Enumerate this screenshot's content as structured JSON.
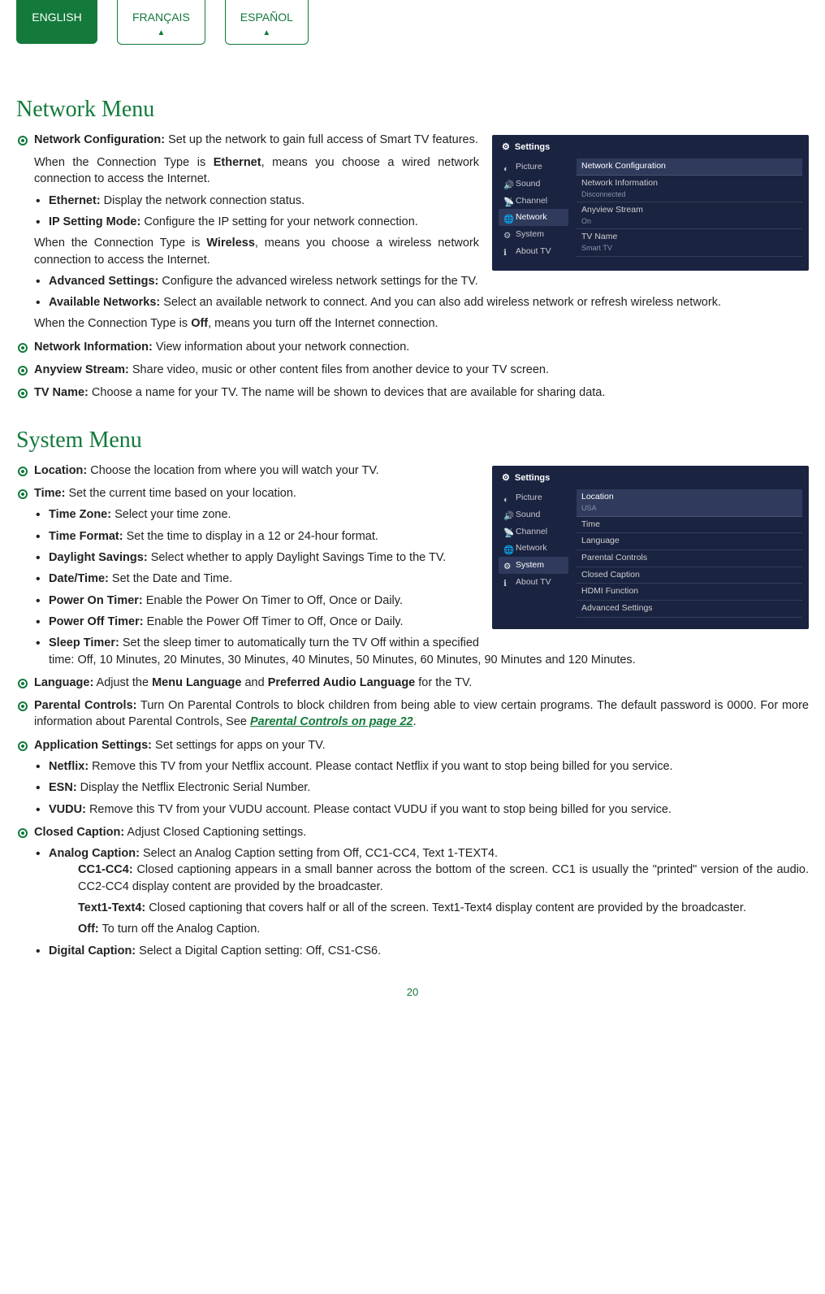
{
  "langs": {
    "en": "ENGLISH",
    "fr": "FRANÇAIS",
    "es": "ESPAÑOL"
  },
  "sec1": {
    "title": "Network Menu",
    "netconf": {
      "label": "Network Configuration:",
      "text": " Set up the network to gain full access of Smart TV features."
    },
    "ethernet_intro_a": "When the Connection Type is ",
    "ethernet_intro_b": "Ethernet",
    "ethernet_intro_c": ", means you choose a wired network connection to access the Internet.",
    "eth": {
      "label": "Ethernet:",
      "text": " Display the network connection status."
    },
    "ip": {
      "label": "IP Setting Mode:",
      "text": " Configure the IP setting for your network connection."
    },
    "wireless_intro_a": "When the Connection Type is ",
    "wireless_intro_b": "Wireless",
    "wireless_intro_c": ", means you choose a wireless network connection to access the Internet.",
    "adv": {
      "label": "Advanced Settings:",
      "text": " Configure the advanced wireless network settings for the TV."
    },
    "avail": {
      "label": "Available Networks:",
      "text": " Select an available network to connect. And you can also add wireless network or refresh wireless network."
    },
    "off_intro_a": "When the Connection Type is ",
    "off_intro_b": "Off",
    "off_intro_c": ", means you turn off the Internet connection.",
    "netinfo": {
      "label": "Network Information:",
      "text": " View information about your network connection."
    },
    "anyview": {
      "label": "Anyview Stream:",
      "text": " Share video, music or other content files from another device to your TV screen."
    },
    "tvname": {
      "label": "TV Name:",
      "text": " Choose a name for your TV. The name will be shown to devices that are available for sharing data."
    }
  },
  "sec2": {
    "title": "System Menu",
    "loc": {
      "label": "Location:",
      "text": " Choose the location from where you will watch your TV."
    },
    "time": {
      "label": "Time:",
      "text": " Set the current time based on your location."
    },
    "tz": {
      "label": "Time Zone:",
      "text": " Select your time zone."
    },
    "tf": {
      "label": "Time Format:",
      "text": " Set the time to display in a 12 or 24-hour format."
    },
    "ds": {
      "label": "Daylight Savings:",
      "text": " Select whether to apply Daylight Savings Time to the TV."
    },
    "dt": {
      "label": "Date/Time:",
      "text": " Set the Date and Time."
    },
    "pon": {
      "label": "Power On Timer:",
      "text": " Enable the Power On Timer to Off, Once or Daily."
    },
    "poff": {
      "label": "Power Off Timer:",
      "text": " Enable the Power Off Timer to Off, Once or Daily."
    },
    "sleep": {
      "label": "Sleep Timer:",
      "text": " Set the sleep timer to automatically turn the TV Off within a specified time: Off, 10 Minutes, 20 Minutes, 30 Minutes, 40 Minutes, 50 Minutes, 60 Minutes, 90 Minutes and 120 Minutes."
    },
    "lang_a": "Language:",
    "lang_b": " Adjust the ",
    "lang_c": "Menu Language",
    "lang_d": " and ",
    "lang_e": "Preferred Audio Language",
    "lang_f": " for the TV.",
    "pc_a": "Parental Controls:",
    "pc_b": " Turn On Parental Controls to block children from being able to view certain programs. The default password is 0000. For more information about Parental Controls, See ",
    "pc_link": "Parental Controls on page 22",
    "pc_c": ".",
    "app": {
      "label": "Application Settings:",
      "text": " Set settings for apps on your TV."
    },
    "netflix": {
      "label": "Netflix:",
      "text": " Remove this TV from your Netflix account. Please contact Netflix if you want to stop being billed for you service."
    },
    "esn": {
      "label": "ESN:",
      "text": " Display the Netflix Electronic Serial Number."
    },
    "vudu": {
      "label": "VUDU:",
      "text": " Remove this TV from your VUDU account. Please contact VUDU if you want to stop being billed for you service."
    },
    "cc": {
      "label": "Closed Caption:",
      "text": " Adjust Closed Captioning settings."
    },
    "analog": {
      "label": "Analog Caption:",
      "text": " Select an Analog Caption setting from Off, CC1-CC4, Text 1-TEXT4."
    },
    "cc14": {
      "label": "CC1-CC4:",
      "text": " Closed captioning appears in a small banner across the bottom of the screen. CC1 is usually the \"printed\" version of the audio. CC2-CC4 display content are provided by the broadcaster."
    },
    "t14": {
      "label": "Text1-Text4:",
      "text": " Closed captioning that covers half or all of the screen. Text1-Text4 display content are provided by the broadcaster."
    },
    "offcap": {
      "label": "Off:",
      "text": " To turn off the Analog Caption."
    },
    "digital": {
      "label": "Digital Caption:",
      "text": " Select a Digital Caption setting: Off, CS1-CS6."
    }
  },
  "shot1": {
    "title": "Settings",
    "side": [
      "Picture",
      "Sound",
      "Channel",
      "Network",
      "System",
      "About TV"
    ],
    "sel_index": 3,
    "rows": [
      {
        "label": "Network Configuration",
        "sub": ""
      },
      {
        "label": "Network Information",
        "sub": "Disconnected"
      },
      {
        "label": "Anyview Stream",
        "sub": "On"
      },
      {
        "label": "TV Name",
        "sub": "Smart TV"
      }
    ]
  },
  "shot2": {
    "title": "Settings",
    "side": [
      "Picture",
      "Sound",
      "Channel",
      "Network",
      "System",
      "About TV"
    ],
    "sel_index": 4,
    "rows": [
      {
        "label": "Location",
        "sub": "USA"
      },
      {
        "label": "Time",
        "sub": ""
      },
      {
        "label": "Language",
        "sub": ""
      },
      {
        "label": "Parental Controls",
        "sub": ""
      },
      {
        "label": "Closed Caption",
        "sub": ""
      },
      {
        "label": "HDMI Function",
        "sub": ""
      },
      {
        "label": "Advanced Settings",
        "sub": ""
      }
    ]
  },
  "page_number": "20"
}
